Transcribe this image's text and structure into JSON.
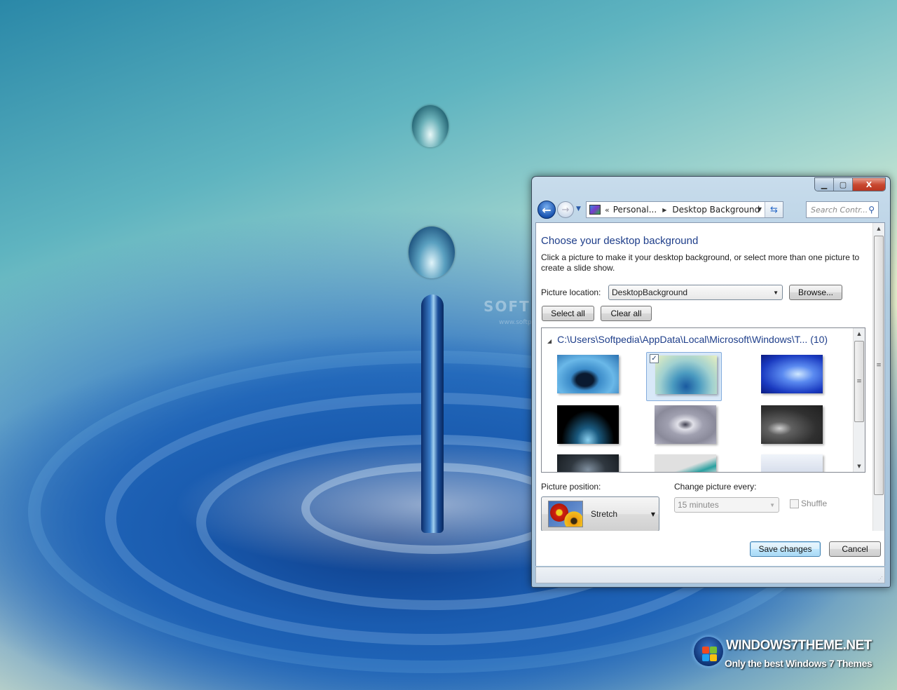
{
  "desktop": {
    "wallpaper": "water-drop-ripple",
    "watermark": "SOFTPEDIA",
    "watermark_url": "www.softpedia.com",
    "logo": {
      "title": "WINDOWS7THEME.NET",
      "subtitle": "Only the best Windows 7 Themes"
    }
  },
  "window": {
    "controls": {
      "minimize": "minimize",
      "maximize": "maximize",
      "close": "X"
    },
    "nav": {
      "back_icon": "arrow-left",
      "forward_icon": "arrow-right",
      "breadcrumb_overflow": "«",
      "breadcrumb": [
        "Personal...",
        "Desktop Background"
      ],
      "search_placeholder": "Search Contr..."
    },
    "page": {
      "title": "Choose your desktop background",
      "description": "Click a picture to make it your desktop background, or select more than one picture to create a slide show.",
      "picture_location_label": "Picture location:",
      "picture_location_value": "DesktopBackground",
      "browse_label": "Browse...",
      "select_all_label": "Select all",
      "clear_all_label": "Clear all",
      "group_header": "C:\\Users\\Softpedia\\AppData\\Local\\Microsoft\\Windows\\T... (10)",
      "thumbnails": [
        {
          "name": "water-splash-crater",
          "selected": false
        },
        {
          "name": "water-drop-ripple",
          "selected": true
        },
        {
          "name": "blue-water-splash",
          "selected": false
        },
        {
          "name": "glass-splash-dark",
          "selected": false
        },
        {
          "name": "gray-ripple-drop",
          "selected": false
        },
        {
          "name": "rain-drops-bw",
          "selected": false
        },
        {
          "name": "dark-splash",
          "selected": false
        },
        {
          "name": "teal-wave-splash",
          "selected": false
        },
        {
          "name": "light-drops",
          "selected": false
        }
      ],
      "picture_position_label": "Picture position:",
      "picture_position_value": "Stretch",
      "change_picture_label": "Change picture every:",
      "change_picture_value": "15 minutes",
      "shuffle_label": "Shuffle",
      "shuffle_checked": false,
      "save_label": "Save changes",
      "cancel_label": "Cancel",
      "checkmark": "✓"
    }
  }
}
